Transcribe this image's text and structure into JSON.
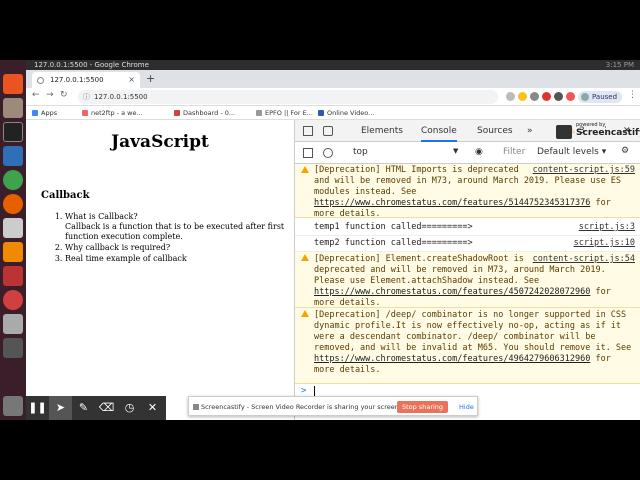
{
  "window": {
    "title": "127.0.0.1:5500 - Google Chrome",
    "clock": "3:15 PM"
  },
  "tab": {
    "title": "127.0.0.1:5500",
    "close": "×",
    "new": "+"
  },
  "omnibox": {
    "url": "127.0.0.1:5500",
    "info_glyph": "ⓘ"
  },
  "nav": {
    "back": "←",
    "forward": "→",
    "reload": "↻"
  },
  "profile": {
    "status": "Paused"
  },
  "bookmarks": [
    "Apps",
    "net2ftp - a we...",
    "Dashboard - 0...",
    "EPFO || For E...",
    "Online Video..."
  ],
  "page": {
    "heading": "JavaScript",
    "subheading": "Callback",
    "list": [
      {
        "title": "What is Callback?",
        "detail": "Callback is a function that is to be executed after first function execution complete."
      },
      {
        "title": "Why callback is required?",
        "detail": ""
      },
      {
        "title": "Real time example of callback",
        "detail": ""
      }
    ]
  },
  "devtools": {
    "tabs": [
      "Elements",
      "Console",
      "Sources"
    ],
    "more": "»",
    "warn_count": "3",
    "context": "top",
    "filter_placeholder": "Filter",
    "levels": "Default levels ▾",
    "messages": [
      {
        "type": "warn",
        "text": "[Deprecation] HTML Imports is deprecated and will be removed in M73, around March 2019. Please use ES modules instead. See ",
        "link": "https://www.chromestatus.com/features/5144752345317376",
        "tail": " for more details.",
        "src": "content-script.js:59"
      },
      {
        "type": "log",
        "text": "temp1 function called=========>",
        "link": "",
        "tail": "",
        "src": "script.js:3"
      },
      {
        "type": "log",
        "text": "temp2 function called=========>",
        "link": "",
        "tail": "",
        "src": "script.js:10"
      },
      {
        "type": "warn",
        "text": "[Deprecation] Element.createShadowRoot is deprecated and will be removed in M73, around March 2019. Please use Element.attachShadow instead. See ",
        "link": "https://www.chromestatus.com/features/4507242028072960",
        "tail": " for more details.",
        "src": "content-script.js:54"
      },
      {
        "type": "warn",
        "text": "[Deprecation] /deep/ combinator is no longer supported in CSS dynamic profile.It is now effectively no-op, acting as if it were a descendant combinator. /deep/ combinator will be removed, and will be invalid at M65. You should remove it. See ",
        "link": "https://www.chromestatus.com/features/4964279606312960",
        "tail": " for more details.",
        "src": ""
      }
    ],
    "prompt": ">"
  },
  "screencastify": {
    "share_text": "Screencastify - Screen Video Recorder is sharing your screen.",
    "stop_label": "Stop sharing",
    "hide_label": "Hide",
    "watermark_small": "powered by",
    "watermark_name": "Screencastify"
  },
  "colors": {
    "accent": "#1a73e8",
    "warn_bg": "#fffbe5",
    "launcher": "#3a1f2a",
    "stop": "#e8735a"
  }
}
